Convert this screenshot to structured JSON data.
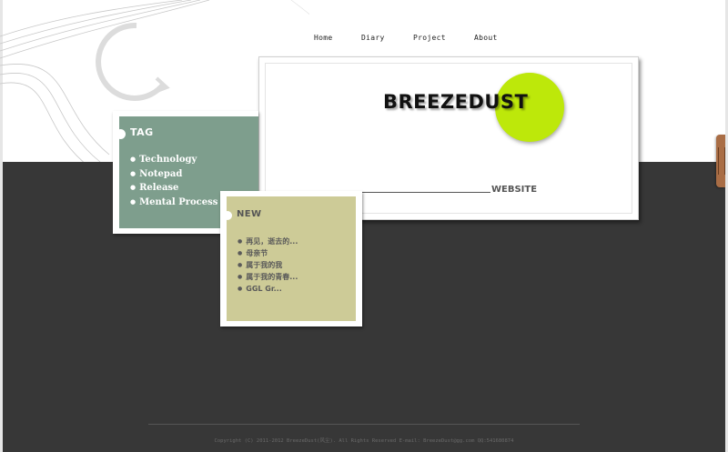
{
  "nav": {
    "home": "Home",
    "diary": "Diary",
    "project": "Project",
    "about": "About"
  },
  "hero": {
    "brand": "BREEZEDUST",
    "subtitle": "WEBSITE",
    "accent_color": "#bde80a"
  },
  "tag_panel": {
    "title": "TAG",
    "items": [
      "Technology",
      "Notepad",
      "Release",
      "Mental Process"
    ],
    "color": "#7e9e8d"
  },
  "new_panel": {
    "title": "NEW",
    "items": [
      "再见，逝去的...",
      "母亲节",
      "属于我的我",
      "属于我的青春...",
      "GGL Gr..."
    ],
    "color": "#cdcb97"
  },
  "footer": {
    "text": "Copyright (C) 2011-2012  BreezeDust(风尘). All Rights Reserved  E-mail: BreezeDust@gg.com  QQ:541680874"
  },
  "theme": {
    "dark_band": "#373737",
    "background": "#ffffff"
  }
}
